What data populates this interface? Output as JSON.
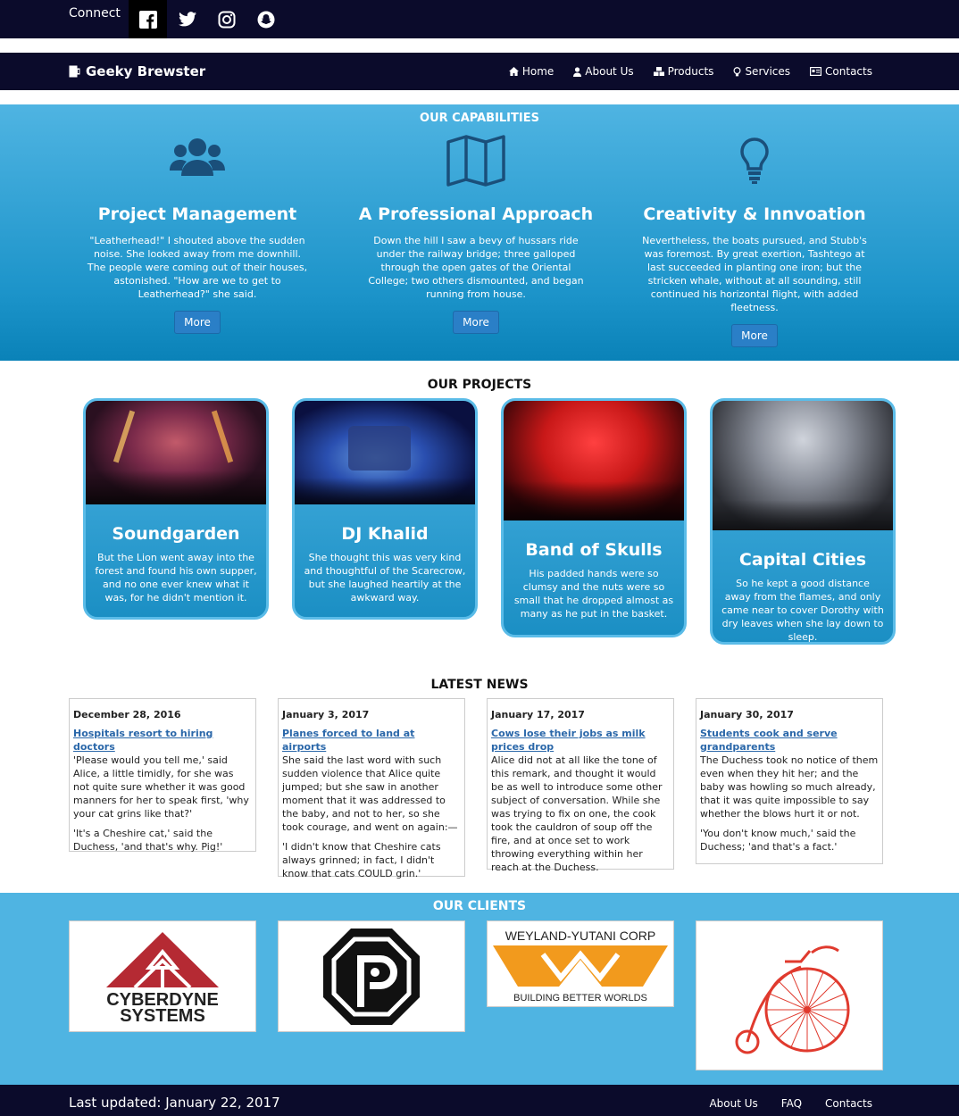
{
  "topbar": {
    "connect_label": "Connect"
  },
  "brand": {
    "name": "Geeky Brewster"
  },
  "nav": [
    {
      "label": "Home",
      "icon": "home-icon"
    },
    {
      "label": "About Us",
      "icon": "user-icon"
    },
    {
      "label": "Products",
      "icon": "cubes-icon"
    },
    {
      "label": "Services",
      "icon": "lightbulb-icon"
    },
    {
      "label": "Contacts",
      "icon": "contact-card-icon"
    }
  ],
  "capabilities": {
    "title": "OUR CAPABILITIES",
    "items": [
      {
        "title": "Project Management",
        "icon": "users-icon",
        "text": "\"Leatherhead!\" I shouted above the sudden noise. She looked away from me downhill. The people were coming out of their houses, astonished. \"How are we to get to Leatherhead?\" she said.",
        "button": "More"
      },
      {
        "title": "A Professional Approach",
        "icon": "map-icon",
        "text": "Down the hill I saw a bevy of hussars ride under the railway bridge; three galloped through the open gates of the Oriental College; two others dismounted, and began running from house.",
        "button": "More"
      },
      {
        "title": "Creativity & Innvoation",
        "icon": "lightbulb-icon",
        "text": "Nevertheless, the boats pursued, and Stubb's was foremost. By great exertion, Tashtego at last succeeded in planting one iron; but the stricken whale, without at all sounding, still continued his horizontal flight, with added fleetness.",
        "button": "More"
      }
    ]
  },
  "projects": {
    "title": "OUR PROJECTS",
    "items": [
      {
        "title": "Soundgarden",
        "text": "But the Lion went away into the forest and found his own supper, and no one ever knew what it was, for he didn't mention it."
      },
      {
        "title": "DJ Khalid",
        "text": "She thought this was very kind and thoughtful of the Scarecrow, but she laughed heartily at the awkward way."
      },
      {
        "title": "Band of Skulls",
        "text": "His padded hands were so clumsy and the nuts were so small that he dropped almost as many as he put in the basket."
      },
      {
        "title": "Capital Cities",
        "text": "So he kept a good distance away from the flames, and only came near to cover Dorothy with dry leaves when she lay down to sleep."
      }
    ]
  },
  "news": {
    "title": "LATEST NEWS",
    "items": [
      {
        "date": "December 28, 2016",
        "headline": "Hospitals resort to hiring doctors",
        "paras": [
          "'Please would you tell me,' said Alice, a little timidly, for she was not quite sure whether it was good manners for her to speak first, 'why your cat grins like that?'",
          "'It's a Cheshire cat,' said the Duchess, 'and that's why. Pig!'"
        ]
      },
      {
        "date": "January 3, 2017",
        "headline": "Planes forced to land at airports",
        "paras": [
          "She said the last word with such sudden violence that Alice quite jumped; but she saw in another moment that it was addressed to the baby, and not to her, so she took courage, and went on again:—",
          "'I didn't know that Cheshire cats always grinned; in fact, I didn't know that cats COULD grin.'"
        ]
      },
      {
        "date": "January 17, 2017",
        "headline": "Cows lose their jobs as milk prices drop",
        "paras": [
          "Alice did not at all like the tone of this remark, and thought it would be as well to introduce some other subject of conversation. While she was trying to fix on one, the cook took the cauldron of soup off the fire, and at once set to work throwing everything within her reach at the Duchess."
        ]
      },
      {
        "date": "January 30, 2017",
        "headline": "Students cook and serve grandparents",
        "paras": [
          "The Duchess took no notice of them even when they hit her; and the baby was howling so much already, that it was quite impossible to say whether the blows hurt it or not.",
          "'You don't know much,' said the Duchess; 'and that's a fact.'"
        ]
      }
    ]
  },
  "clients": {
    "title": "OUR CLIENTS",
    "cyberdyne": [
      "CYBERDYNE",
      "SYSTEMS"
    ],
    "weyland": {
      "top": "WEYLAND-YUTANI CORP",
      "bottom": "BUILDING BETTER WORLDS"
    }
  },
  "footer": {
    "updated": "Last updated: January 22, 2017",
    "links": [
      "About Us",
      "FAQ",
      "Contacts"
    ]
  },
  "colors": {
    "navy": "#0b0b2b",
    "sky": "#4fb4e2",
    "button": "#2a7fc7",
    "link": "#2a67a9"
  }
}
